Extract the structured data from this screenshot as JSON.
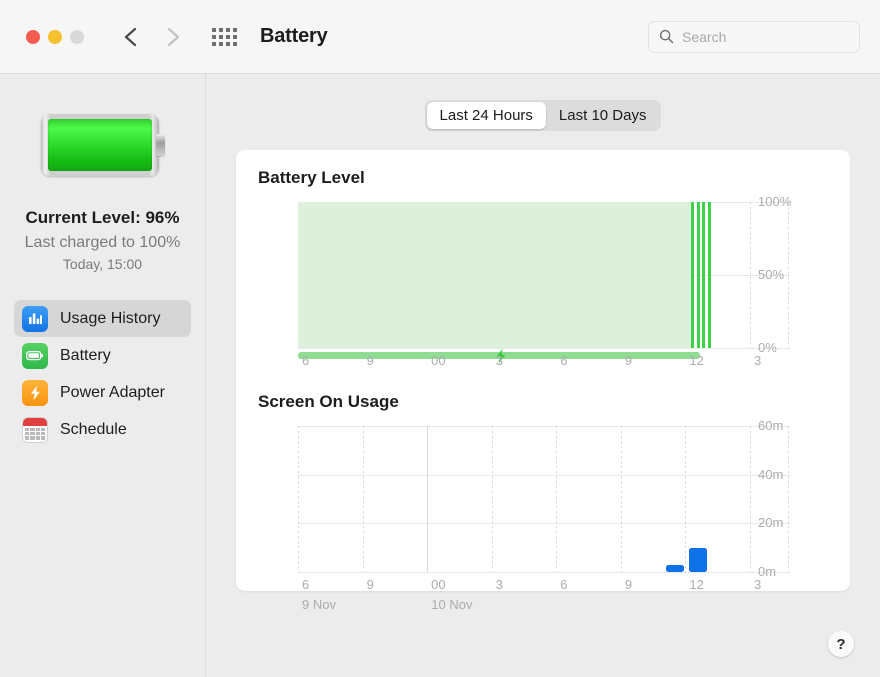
{
  "window": {
    "title": "Battery",
    "traffic_lights": [
      "close",
      "minimize",
      "zoom-disabled"
    ],
    "nav": {
      "back": "back-chevron",
      "forward": "forward-chevron"
    },
    "grid_icon": "show-all-icon"
  },
  "search": {
    "placeholder": "Search",
    "value": "",
    "icon": "search-icon"
  },
  "sidebar": {
    "battery_icon": "battery-full-icon",
    "current_level": "Current Level: 96%",
    "last_charged": "Last charged to 100%",
    "last_charged_time": "Today, 15:00",
    "items": [
      {
        "label": "Usage History",
        "icon": "bar-chart-icon",
        "selected": true
      },
      {
        "label": "Battery",
        "icon": "battery-icon",
        "selected": false
      },
      {
        "label": "Power Adapter",
        "icon": "lightning-bolt-icon",
        "selected": false
      },
      {
        "label": "Schedule",
        "icon": "calendar-icon",
        "selected": false
      }
    ]
  },
  "segmented": {
    "options": [
      "Last 24 Hours",
      "Last 10 Days"
    ],
    "selected": "Last 24 Hours"
  },
  "help_button": {
    "label": "?"
  },
  "colors": {
    "battery_fill": "#dcf0dc",
    "battery_spike": "#3ed14a",
    "charge_bar": "#8fdd92",
    "usage_bar": "#1072e8",
    "accent_blue": "#1273e6"
  },
  "chart_data": [
    {
      "type": "area",
      "title": "Battery Level",
      "xlabel": "",
      "ylabel": "",
      "ylim": [
        0,
        100
      ],
      "yticks": [
        0,
        50,
        100
      ],
      "ytick_labels": [
        "0%",
        "50%",
        "100%"
      ],
      "xtick_labels": [
        "6",
        "9",
        "00",
        "3",
        "6",
        "9",
        "12",
        "3"
      ],
      "x_positions_pct": [
        0,
        14.3,
        28.6,
        42.9,
        57.1,
        71.4,
        85.7,
        100
      ],
      "series": [
        {
          "name": "Battery Level",
          "fill_start_pct": 0,
          "fill_end_pct": 87,
          "value": 100
        }
      ],
      "charge_spikes_pct": [
        87.0,
        88.2,
        89.4,
        90.6
      ],
      "charging_bar": {
        "start_pct": 0,
        "end_pct": 89,
        "label": "charging"
      },
      "charging_marker": {
        "position_pct": 45,
        "icon": "lightning-bolt-icon"
      },
      "grid": true,
      "legend": "none"
    },
    {
      "type": "bar",
      "title": "Screen On Usage",
      "xlabel": "",
      "ylabel": "",
      "ylim": [
        0,
        60
      ],
      "yticks": [
        0,
        20,
        40,
        60
      ],
      "ytick_labels": [
        "0m",
        "20m",
        "40m",
        "60m"
      ],
      "xtick_labels": [
        "6",
        "9",
        "00",
        "3",
        "6",
        "9",
        "12",
        "3"
      ],
      "date_labels": [
        {
          "text": "9 Nov",
          "position_pct": 0
        },
        {
          "text": "10 Nov",
          "position_pct": 28.6
        }
      ],
      "bars": [
        {
          "x_pct": 83.5,
          "value": 3
        },
        {
          "x_pct": 88.5,
          "value": 10
        }
      ],
      "grid": true,
      "legend": "none"
    }
  ]
}
